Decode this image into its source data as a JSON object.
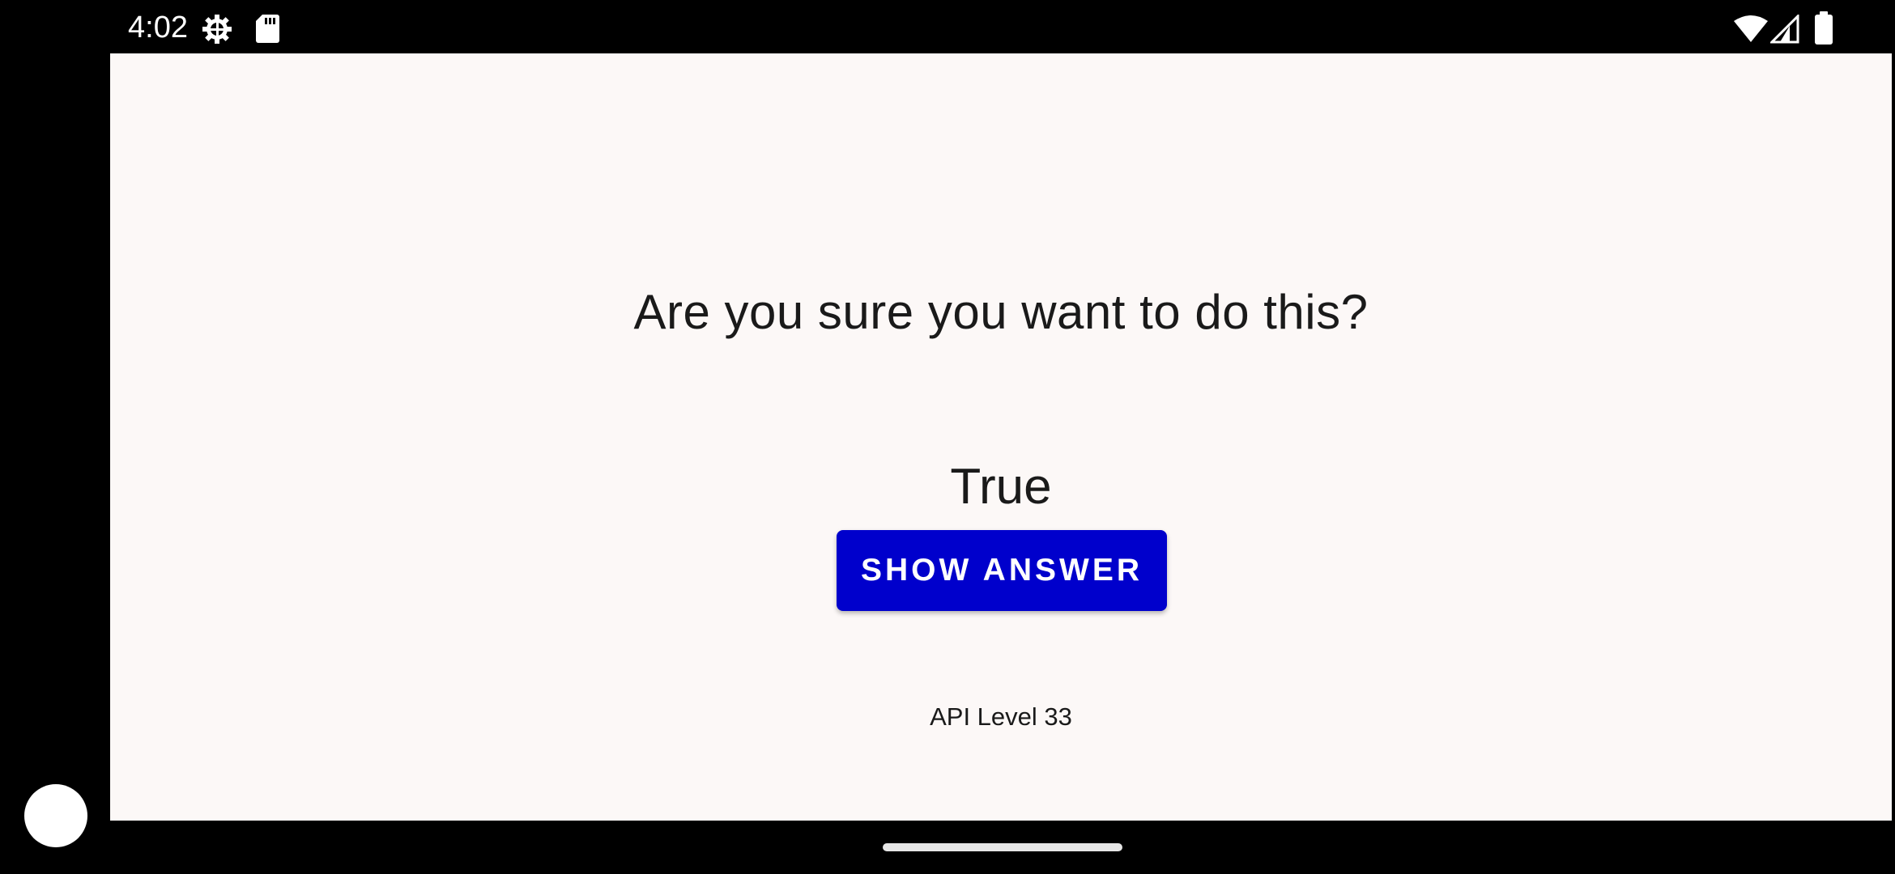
{
  "status_bar": {
    "time": "4:02",
    "icons_left": [
      "settings-gear-icon",
      "sd-card-icon"
    ],
    "icons_right": [
      "wifi-icon",
      "cellular-signal-icon",
      "battery-icon"
    ]
  },
  "content": {
    "question": "Are you sure you want to do this?",
    "answer": "True",
    "show_answer_label": "SHOW ANSWER",
    "api_level": "API Level 33"
  },
  "colors": {
    "button_background": "#0000cc",
    "screen_background": "#fcf8f7",
    "frame": "#000000"
  }
}
